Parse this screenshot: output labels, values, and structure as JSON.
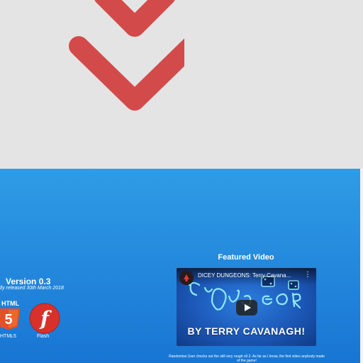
{
  "colors": {
    "accent_red": "#d34a4a",
    "panel_blue_top": "#2f9ce6",
    "panel_blue_bottom": "#1875d3",
    "text_light": "#ffffff"
  },
  "hero": {
    "icon": "double-chevron-down-icon"
  },
  "version": {
    "title": "Version 0.3",
    "subtitle": "lly released 30th March 2018",
    "platforms": [
      {
        "icon": "html5-icon",
        "badge": "HTML",
        "number": "5",
        "label": "HTML5"
      },
      {
        "icon": "flash-icon",
        "glyph": "f",
        "label": "Flash"
      }
    ]
  },
  "featured": {
    "heading": "Featured Video",
    "video_title": "DICEY DUNGEONS: Terry Cavana...",
    "video_byline": "BY TERRY CAVANAGH!",
    "more_icon": "more-vertical-icon",
    "play_icon": "play-icon",
    "description": "Randomise User checks out the still very rough v0.2. As far as I know, the first video anybody made of the game!"
  }
}
